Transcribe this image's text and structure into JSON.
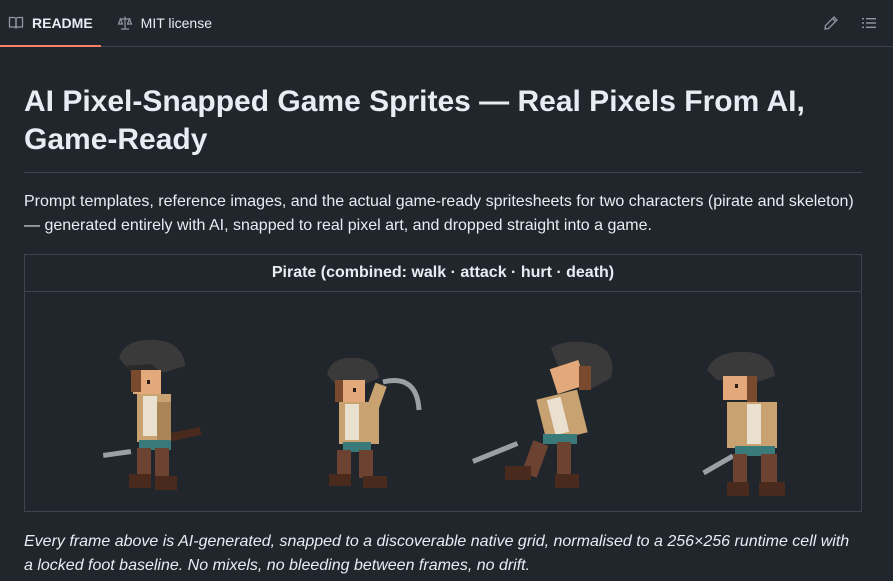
{
  "tabs": [
    {
      "label": "README",
      "icon": "book-icon",
      "active": true
    },
    {
      "label": "MIT license",
      "icon": "scale-icon",
      "active": false
    }
  ],
  "toolbar": {
    "edit_icon": "pencil-icon",
    "outline_icon": "list-icon"
  },
  "readme": {
    "title": "AI Pixel-Snapped Game Sprites — Real Pixels From AI, Game-Ready",
    "intro": "Prompt templates, reference images, and the actual game-ready spritesheets for two characters (pirate and skeleton) — generated entirely with AI, snapped to real pixel art, and dropped straight into a game.",
    "figure_caption": "Pirate (combined: walk · attack · hurt · death)",
    "frames": [
      "walk",
      "attack",
      "hurt",
      "death"
    ],
    "note": "Every frame above is AI-generated, snapped to a discoverable native grid, normalised to a 256×256 runtime cell with a locked foot baseline. No mixels, no bleeding between frames, no drift."
  },
  "colors": {
    "background": "#21262d",
    "border": "#3d444d",
    "text": "#e6edf3",
    "tab_accent": "#f78166"
  }
}
